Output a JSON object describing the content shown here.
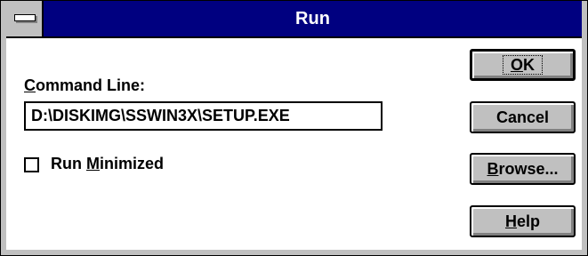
{
  "window": {
    "title": "Run",
    "system_menu_icon": "system-menu-bar-icon"
  },
  "command_line": {
    "label_hotkey": "C",
    "label_rest": "ommand Line:",
    "value": "D:\\DISKIMG\\SSWIN3X\\SETUP.EXE"
  },
  "run_minimized": {
    "checked": false,
    "label_prefix": "Run ",
    "label_hotkey": "M",
    "label_rest": "inimized"
  },
  "buttons": {
    "ok_hotkey": "O",
    "ok_rest": "K",
    "cancel": "Cancel",
    "browse_hotkey": "B",
    "browse_rest": "rowse...",
    "help_hotkey": "H",
    "help_rest": "elp"
  },
  "colors": {
    "titlebar": "#000080",
    "face": "#c0c0c0",
    "window": "#ffffff"
  }
}
